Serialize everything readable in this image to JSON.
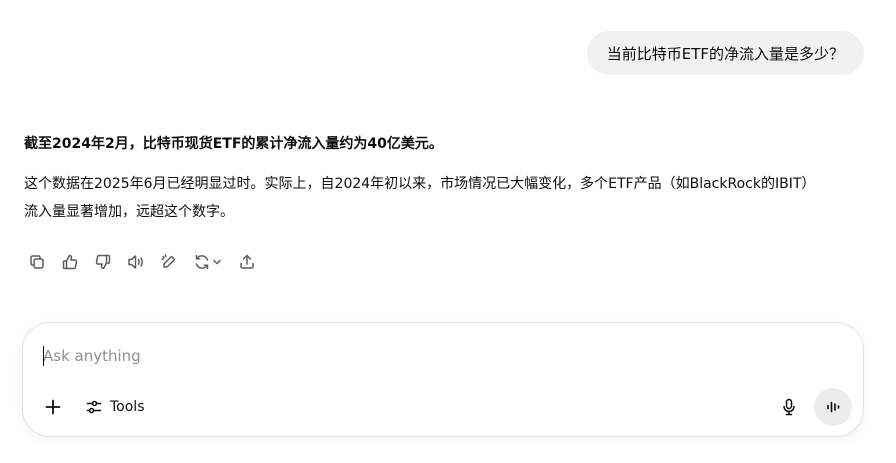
{
  "user_message": {
    "text": "当前比特币ETF的净流入量是多少？"
  },
  "assistant_message": {
    "headline": "截至2024年2月，比特币现货ETF的累计净流入量约为40亿美元。",
    "body": "这个数据在2025年6月已经明显过时。实际上，自2024年初以来，市场情况已大幅变化，多个ETF产品（如BlackRock的IBIT）流入量显著增加，远超这个数字。"
  },
  "message_actions": {
    "icons": [
      "copy-icon",
      "thumbs-up-icon",
      "thumbs-down-icon",
      "read-aloud-icon",
      "edit-icon",
      "regenerate-icon",
      "chevron-down-icon",
      "share-icon"
    ]
  },
  "composer": {
    "placeholder": "Ask anything",
    "value": "",
    "tools_label": "Tools",
    "icons": [
      "plus-icon",
      "sliders-icon",
      "microphone-icon",
      "voice-mode-icon"
    ]
  },
  "colors": {
    "user_bubble_bg": "#f1f1f1",
    "text": "#0d0d0d",
    "icon": "#5d5d5d",
    "placeholder": "#8f8f8f",
    "voice_button_bg": "#ececec"
  }
}
